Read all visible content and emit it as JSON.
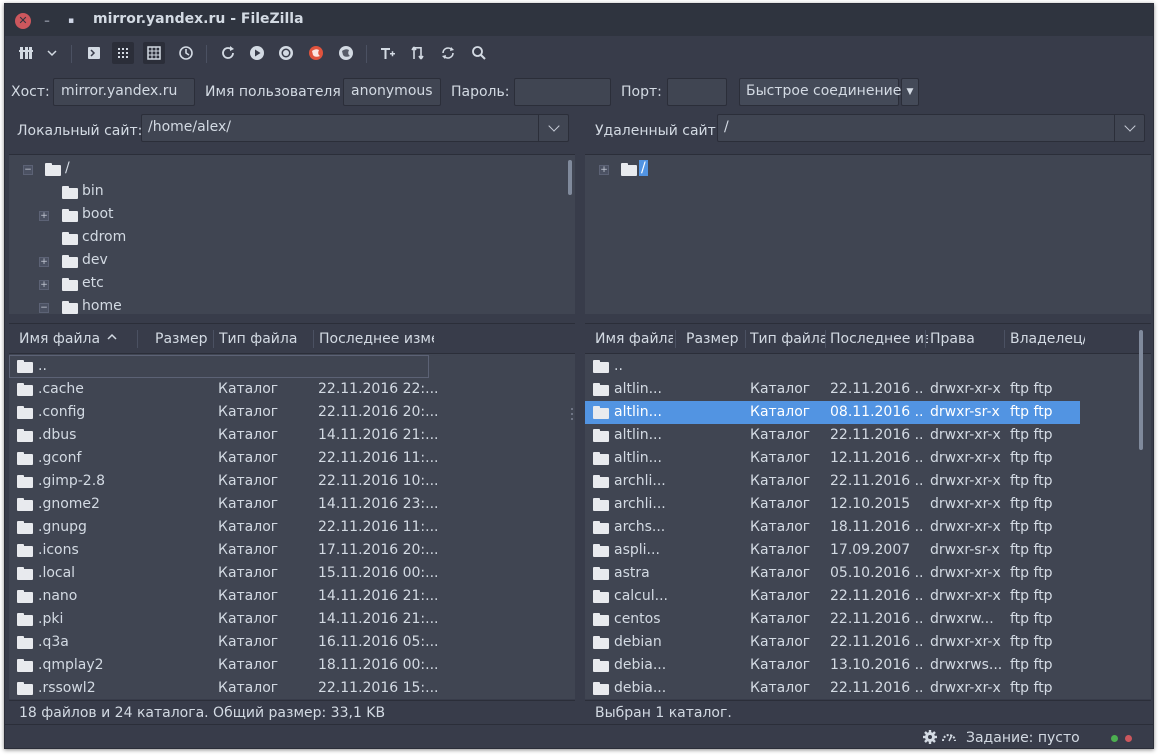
{
  "window": {
    "title": "mirror.yandex.ru - FileZilla",
    "close_symbol": "✕",
    "minimize_symbol": "–",
    "maximize_symbol": "▪"
  },
  "toolbar": {
    "icons": [
      "site-manager-icon",
      "chevron-down-icon",
      "message-log-icon",
      "local-tree-icon",
      "remote-tree-icon",
      "transfer-queue-icon",
      "refresh-icon",
      "process-queue-icon",
      "cancel-icon",
      "disconnect-icon",
      "reconnect-icon",
      "filter-icon",
      "compare-icon",
      "sync-browse-icon",
      "search-icon"
    ]
  },
  "quickconnect": {
    "host_label": "Хост:",
    "host_value": "mirror.yandex.ru",
    "user_label": "Имя пользователя",
    "user_value": "anonymous",
    "pass_label": "Пароль:",
    "pass_value": "",
    "port_label": "Порт:",
    "port_value": "",
    "connect_label": "Быстрое соединение",
    "dropdown_symbol": "▼"
  },
  "local": {
    "site_label": "Локальный сайт:",
    "path": "/home/alex/",
    "tree": [
      {
        "name": "/",
        "expander": "−"
      },
      {
        "name": "bin",
        "expander": ""
      },
      {
        "name": "boot",
        "expander": "+"
      },
      {
        "name": "cdrom",
        "expander": ""
      },
      {
        "name": "dev",
        "expander": "+"
      },
      {
        "name": "etc",
        "expander": "+"
      },
      {
        "name": "home",
        "expander": "−"
      }
    ],
    "columns": [
      "Имя файла",
      "Размер",
      "Тип файла",
      "Последнее изме"
    ],
    "sort_symbol": "^",
    "rows": [
      {
        "name": "..",
        "type": "",
        "date": ""
      },
      {
        "name": ".cache",
        "type": "Каталог",
        "date": "22.11.2016 22:..."
      },
      {
        "name": ".config",
        "type": "Каталог",
        "date": "22.11.2016 20:..."
      },
      {
        "name": ".dbus",
        "type": "Каталог",
        "date": "14.11.2016 21:..."
      },
      {
        "name": ".gconf",
        "type": "Каталог",
        "date": "22.11.2016 11:..."
      },
      {
        "name": ".gimp-2.8",
        "type": "Каталог",
        "date": "22.11.2016 10:..."
      },
      {
        "name": ".gnome2",
        "type": "Каталог",
        "date": "14.11.2016 23:..."
      },
      {
        "name": ".gnupg",
        "type": "Каталог",
        "date": "22.11.2016 11:..."
      },
      {
        "name": ".icons",
        "type": "Каталог",
        "date": "17.11.2016 20:..."
      },
      {
        "name": ".local",
        "type": "Каталог",
        "date": "15.11.2016 00:..."
      },
      {
        "name": ".nano",
        "type": "Каталог",
        "date": "14.11.2016 21:..."
      },
      {
        "name": ".pki",
        "type": "Каталог",
        "date": "14.11.2016 21:..."
      },
      {
        "name": ".q3a",
        "type": "Каталог",
        "date": "16.11.2016 05:..."
      },
      {
        "name": ".qmplay2",
        "type": "Каталог",
        "date": "18.11.2016 00:..."
      },
      {
        "name": ".rssowl2",
        "type": "Каталог",
        "date": "22.11.2016 15:..."
      }
    ],
    "status": "18 файлов и 24 каталога. Общий размер: 33,1 KB"
  },
  "remote": {
    "site_label": "Удаленный сайт:",
    "path": "/",
    "tree": [
      {
        "name": "/",
        "expander": "+"
      }
    ],
    "columns": [
      "Имя файла",
      "Размер",
      "Тип файла",
      "Последнее из",
      "Права",
      "Владелец/"
    ],
    "rows": [
      {
        "name": "..",
        "type": "",
        "date": "",
        "perms": "",
        "owner": ""
      },
      {
        "name": "altlin...",
        "type": "Каталог",
        "date": "22.11.2016 ...",
        "perms": "drwxr-xr-x",
        "owner": "ftp ftp"
      },
      {
        "name": "altlin...",
        "type": "Каталог",
        "date": "08.11.2016 ...",
        "perms": "drwxr-sr-x",
        "owner": "ftp ftp"
      },
      {
        "name": "altlin...",
        "type": "Каталог",
        "date": "22.11.2016 ...",
        "perms": "drwxr-xr-x",
        "owner": "ftp ftp"
      },
      {
        "name": "altlin...",
        "type": "Каталог",
        "date": "12.11.2016 ...",
        "perms": "drwxr-xr-x",
        "owner": "ftp ftp"
      },
      {
        "name": "archli...",
        "type": "Каталог",
        "date": "22.11.2016 ...",
        "perms": "drwxr-xr-x",
        "owner": "ftp ftp"
      },
      {
        "name": "archli...",
        "type": "Каталог",
        "date": "12.10.2015",
        "perms": "drwxr-xr-x",
        "owner": "ftp ftp"
      },
      {
        "name": "archs...",
        "type": "Каталог",
        "date": "18.11.2016 ...",
        "perms": "drwxr-xr-x",
        "owner": "ftp ftp"
      },
      {
        "name": "aspli...",
        "type": "Каталог",
        "date": "17.09.2007",
        "perms": "drwxr-sr-x",
        "owner": "ftp ftp"
      },
      {
        "name": "astra",
        "type": "Каталог",
        "date": "05.10.2016 ...",
        "perms": "drwxr-xr-x",
        "owner": "ftp ftp"
      },
      {
        "name": "calcul...",
        "type": "Каталог",
        "date": "22.11.2016 ...",
        "perms": "drwxr-xr-x",
        "owner": "ftp ftp"
      },
      {
        "name": "centos",
        "type": "Каталог",
        "date": "22.11.2016 ...",
        "perms": "drwxrw...",
        "owner": "ftp ftp"
      },
      {
        "name": "debian",
        "type": "Каталог",
        "date": "22.11.2016 ...",
        "perms": "drwxr-xr-x",
        "owner": "ftp ftp"
      },
      {
        "name": "debia...",
        "type": "Каталог",
        "date": "13.10.2016 ...",
        "perms": "drwxrws...",
        "owner": "ftp ftp"
      },
      {
        "name": "debia...",
        "type": "Каталог",
        "date": "22.11.2016 ...",
        "perms": "drwxr-xr-x",
        "owner": "ftp ftp"
      }
    ],
    "selected_index": 2,
    "status": "Выбран 1 каталог."
  },
  "statusbar": {
    "queue_text": "Задание: пусто"
  },
  "colors": {
    "background": "#383c4a",
    "panel": "#404552",
    "selection": "#5294e2",
    "text": "#d3dae3",
    "led_green": "#4caf50",
    "led_red": "#cc575d"
  }
}
